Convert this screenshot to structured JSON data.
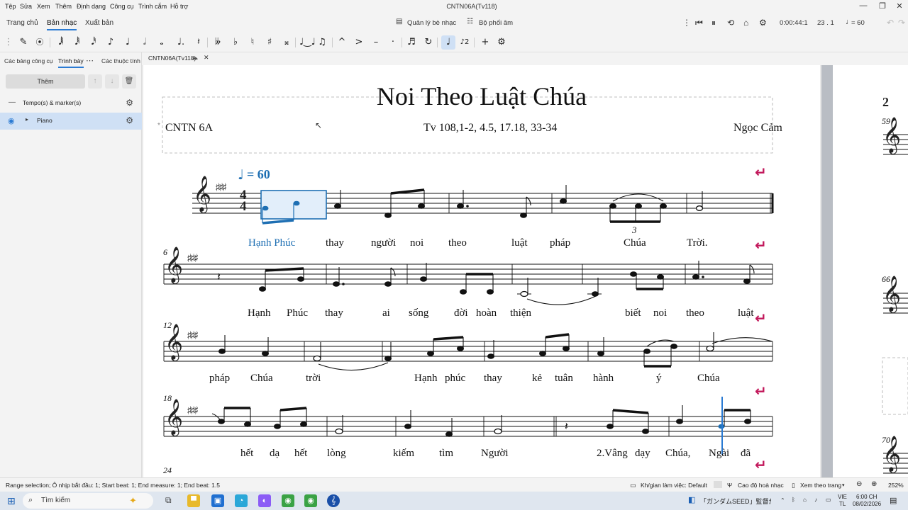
{
  "menubar": {
    "items": [
      "Tệp",
      "Sửa",
      "Xem",
      "Thêm",
      "Định dạng",
      "Công cụ",
      "Trình cắm",
      "Hỗ trợ"
    ],
    "window_title": "CNTN06A(Tv118)"
  },
  "tabs": {
    "items": [
      "Trang chủ",
      "Bản nhạc",
      "Xuất bản"
    ],
    "mixer_label": "Quản lý bè nhạc",
    "arrange_label": "Bộ phối âm",
    "time": "0:00:44:1",
    "position": "23 . 1",
    "tempo": "= 60"
  },
  "toolbar": {
    "tools": [
      "✎",
      "📍",
      "𝅘𝅥𝅲",
      "𝅘𝅥𝅱",
      "𝅘𝅥𝅰",
      "♪",
      "♩",
      "𝅗𝅥",
      "𝅝",
      "•",
      "𝄽",
      "♭♭",
      "♭",
      "♮",
      "♯",
      "𝄪",
      "♩♩",
      "𝅘𝅥𝅮",
      "^",
      ">",
      "–",
      "·",
      "♬",
      "↻",
      "♩",
      "?",
      "+",
      "⚙"
    ]
  },
  "leftpanel": {
    "tabs": [
      "Các bảng công cụ",
      "Trình bày",
      "Các thuộc tính"
    ],
    "add_label": "Thêm",
    "rows": [
      {
        "label": "Tempo(s) & marker(s)"
      },
      {
        "label": "Piano"
      }
    ]
  },
  "doc": {
    "tab_name": "CNTN06A(Tv118)"
  },
  "score": {
    "title": "Noi Theo Luật Chúa",
    "left_header": "CNTN 6A",
    "center_header": "Tv 108,1-2, 4.5, 17.18, 33-34",
    "composer": "Ngọc Cảm",
    "tempo_mark": "= 60",
    "time_sig_top": "4",
    "time_sig_bottom": "4",
    "tuplet": "3",
    "systems": [
      {
        "measure": "",
        "lyrics": [
          "Hạnh Phúc",
          "thay",
          "người",
          "noi",
          "theo",
          "luật",
          "pháp",
          "Chúa",
          "Trời."
        ]
      },
      {
        "measure": "6",
        "lyrics": [
          "Hạnh",
          "Phúc",
          "thay",
          "ai",
          "sống",
          "đời",
          "hoàn",
          "thiện",
          "biết",
          "noi",
          "theo",
          "luật"
        ]
      },
      {
        "measure": "12",
        "lyrics": [
          "pháp",
          "Chúa",
          "trời",
          "Hạnh",
          "phúc",
          "thay",
          "kẻ",
          "tuân",
          "hành",
          "ý",
          "Chúa"
        ]
      },
      {
        "measure": "18",
        "lyrics": [
          "hết",
          "dạ",
          "hết",
          "lòng",
          "kiếm",
          "tìm",
          "Người",
          "2.Vâng",
          "dạy",
          "Chúa,",
          "Ngài",
          "đã"
        ]
      },
      {
        "measure": "24",
        "lyrics": []
      }
    ],
    "page2": {
      "page_number": "2",
      "measures": [
        "59",
        "66",
        "70"
      ]
    }
  },
  "status": {
    "selection": "Range selection; Ô nhịp bắt đầu: 1; Start beat: 1; End measure: 1; End beat: 1.5",
    "workspace": "Kh/gian làm việc: Default",
    "pitch": "Cao độ hoà nhạc",
    "view_mode": "Xem theo trang",
    "zoom": "252%"
  },
  "taskbar": {
    "search_placeholder": "Tìm kiếm",
    "notification": "「ガンダムSEED」監督が...",
    "lang1": "VIE",
    "lang2": "TL",
    "clock": "6:00 CH",
    "date": "08/02/2026"
  },
  "colors": {
    "accent": "#2b7bd3",
    "return_icon": "#c2185b",
    "lyric_highlight": "#1e6fb3"
  }
}
